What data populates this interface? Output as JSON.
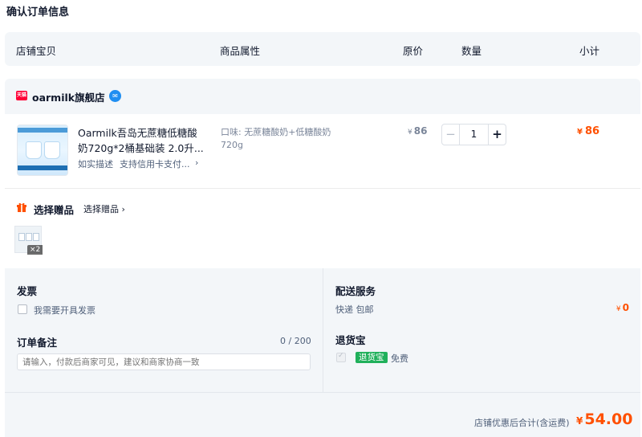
{
  "page": {
    "title": "确认订单信息"
  },
  "columns": {
    "shop": "店铺宝贝",
    "attributes": "商品属性",
    "price": "原价",
    "quantity": "数量",
    "subtotal": "小计"
  },
  "shop": {
    "badge": "天猫",
    "name": "oarmilk旗舰店"
  },
  "item": {
    "title": "Oarmilk吾岛无蔗糖低糖酸奶720g*2桶基础装 2.0升...",
    "tags": [
      "如实描述",
      "支持信用卡支付..."
    ],
    "attributes": "口味: 无蔗糖酸奶+低糖酸奶 720g",
    "price_currency": "¥",
    "price": "86",
    "quantity": "1",
    "subtotal_currency": "¥",
    "subtotal": "86"
  },
  "gift": {
    "title": "选择赠品",
    "link": "选择赠品",
    "count": "×2"
  },
  "invoice": {
    "title": "发票",
    "checkbox_label": "我需要开具发票"
  },
  "note": {
    "title": "订单备注",
    "counter": "0 / 200",
    "placeholder": "请输入，付款后商家可见，建议和商家协商一致"
  },
  "shipping": {
    "title": "配送服务",
    "method": "快递 包邮",
    "fee_currency": "¥",
    "fee": "0"
  },
  "return_insurance": {
    "title": "退货宝",
    "badge": "退货宝",
    "fee_text": "免费"
  },
  "total": {
    "label": "店铺优惠后合计(含运费)",
    "currency": "¥",
    "amount": "54.00"
  },
  "colors": {
    "accent": "#ff5000",
    "tmall": "#ff0036",
    "return_badge": "#20b05b",
    "panel_bg": "#f3f6f9"
  }
}
